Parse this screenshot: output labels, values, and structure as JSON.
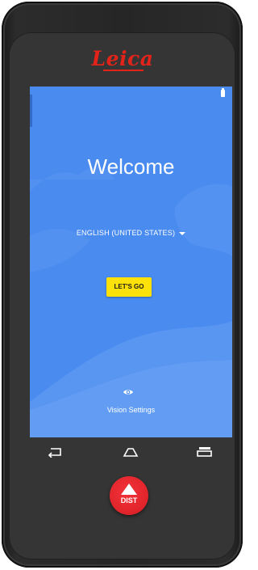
{
  "device": {
    "brand": "Leica",
    "brand_color": "#e2231a"
  },
  "status_bar": {
    "battery_icon": "battery-icon"
  },
  "setup": {
    "title": "Welcome",
    "language": "ENGLISH (UNITED STATES)",
    "language_dropdown_icon": "chevron-down-icon",
    "start_button": "LET'S GO",
    "start_button_color": "#ffe10a",
    "vision_settings_icon": "eye-icon",
    "vision_settings_label": "Vision Settings",
    "background_color": "#4a8bef"
  },
  "nav_bar": {
    "back_icon": "back-icon",
    "home_icon": "home-icon",
    "recents_icon": "recents-icon"
  },
  "hardware_button": {
    "label": "DIST",
    "icon": "triangle-up-icon",
    "color": "#e3262c"
  }
}
